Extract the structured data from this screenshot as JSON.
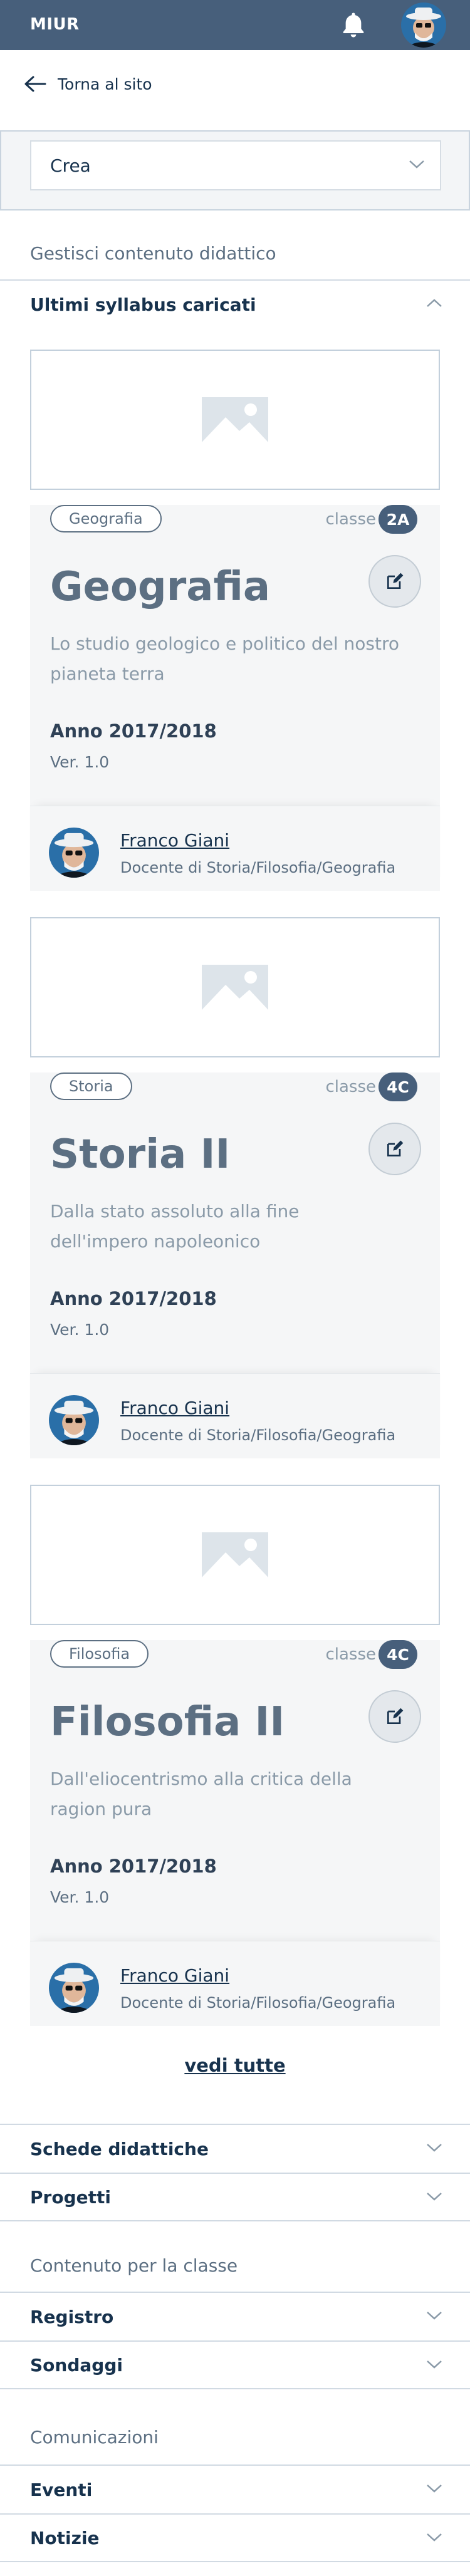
{
  "header": {
    "brand": "MIUR"
  },
  "back": {
    "label": "Torna al sito"
  },
  "crea": {
    "value": "Crea"
  },
  "sections": {
    "gestisci": "Gestisci contenuto didattico",
    "contenuto_classe": "Contenuto per la classe",
    "comunicazioni": "Comunicazioni"
  },
  "accordions": {
    "ultimi": "Ultimi syllabus caricati",
    "schede": "Schede didattiche",
    "progetti": "Progetti",
    "registro": "Registro",
    "sondaggi": "Sondaggi",
    "eventi": "Eventi",
    "notizie": "Notizie"
  },
  "classe_label": "classe",
  "cards": [
    {
      "tag": "Geografia",
      "class": "2A",
      "title": "Geografia",
      "desc": "Lo studio geologico e politico del nostro pianeta terra",
      "year": "Anno 2017/2018",
      "version": "Ver. 1.0",
      "author": "Franco Giani",
      "role": "Docente di Storia/Filosofia/Geografia"
    },
    {
      "tag": "Storia",
      "class": "4C",
      "title": "Storia II",
      "desc": "Dalla stato assoluto alla fine dell'impero napoleonico",
      "year": "Anno 2017/2018",
      "version": "Ver. 1.0",
      "author": "Franco Giani",
      "role": "Docente di Storia/Filosofia/Geografia"
    },
    {
      "tag": "Filosofia",
      "class": "4C",
      "title": "Filosofia II",
      "desc": "Dall'eliocentrismo alla critica della ragion pura",
      "year": "Anno 2017/2018",
      "version": "Ver. 1.0",
      "author": "Franco Giani",
      "role": "Docente di Storia/Filosofia/Geografia"
    }
  ],
  "vedi_tutte": "vedi tutte",
  "icons": {
    "bell": "bell-icon",
    "back": "arrow-left-icon",
    "chevron": "chevron-down-icon",
    "edit": "edit-icon",
    "image": "image-placeholder-icon"
  },
  "colors": {
    "primary": "#475f7b",
    "text": "#17324d",
    "muted": "#5c6f82"
  }
}
